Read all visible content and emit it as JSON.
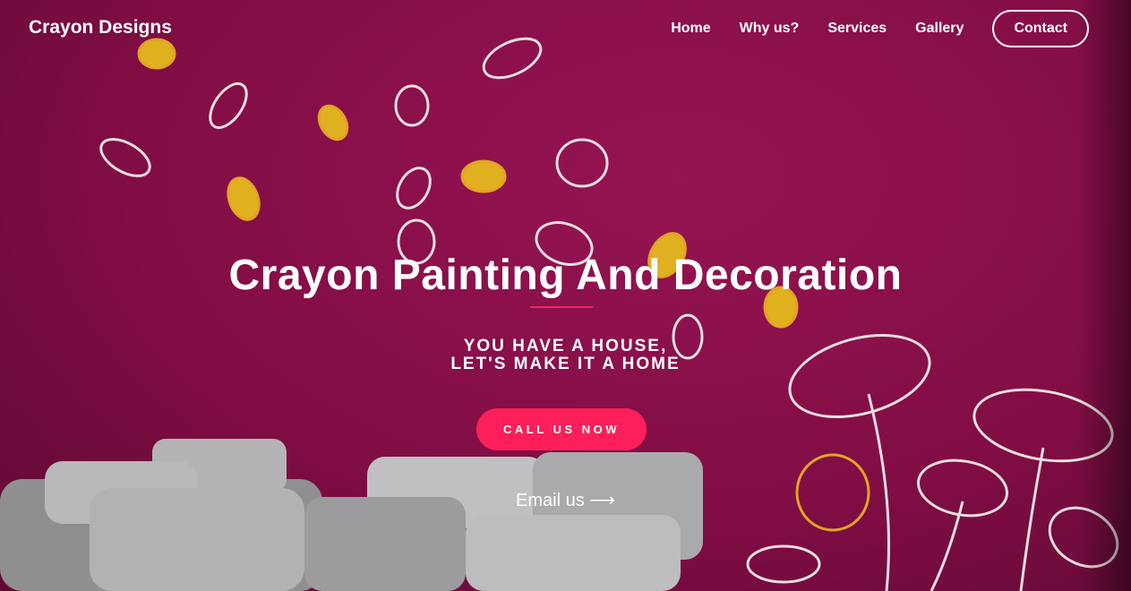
{
  "nav": {
    "brand": "Crayon Designs",
    "items": [
      "Home",
      "Why us?",
      "Services",
      "Gallery"
    ],
    "contact": "Contact"
  },
  "hero": {
    "title": "Crayon Painting And Decoration",
    "subtitle_line1": "YOU HAVE A HOUSE,",
    "subtitle_line2": "LET'S MAKE IT A HOME",
    "cta": "CALL US NOW",
    "email": "Email us",
    "email_icon": "arrow-right-icon"
  },
  "colors": {
    "background": "#820d45",
    "accent": "#fd1f59"
  }
}
